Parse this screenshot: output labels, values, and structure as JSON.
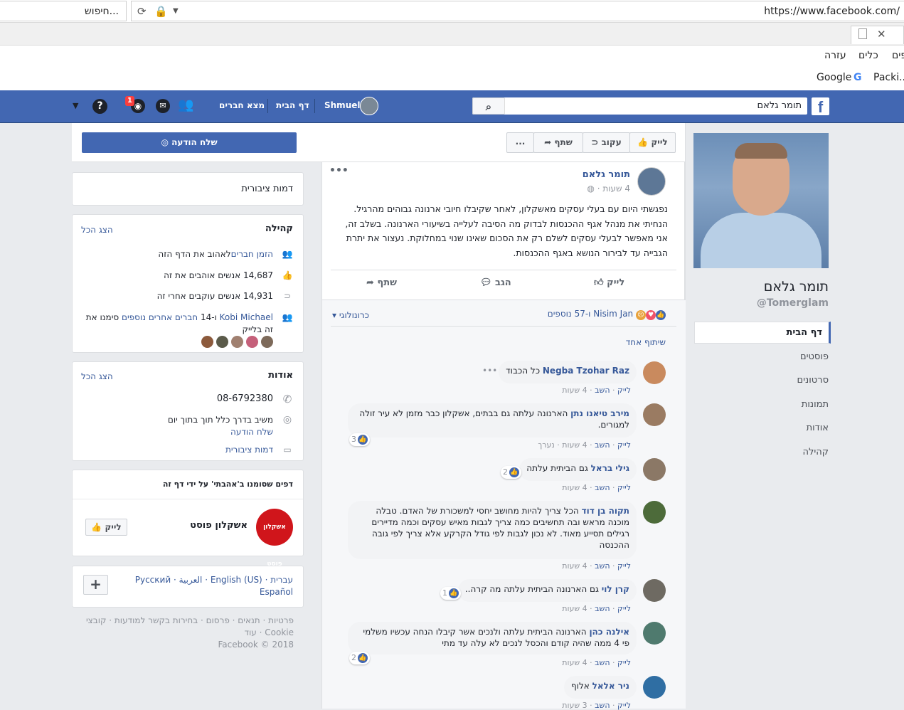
{
  "browser": {
    "search_value": "חיפוש...",
    "url": "https://www.facebook.com/",
    "menu": [
      "פים",
      "כלים",
      "עזרה"
    ],
    "favorites": [
      "Packi...",
      "Google"
    ]
  },
  "fb_header": {
    "search_value": "תומר גלאם",
    "user_name": "Shmuel",
    "home": "דף הבית",
    "find_friends": "מצא חברים",
    "notif_count": "1"
  },
  "profile": {
    "name": "תומר גלאם",
    "username": "@Tomerglam",
    "nav": [
      "דף הבית",
      "פוסטים",
      "סרטונים",
      "תמונות",
      "אודות",
      "קהילה"
    ]
  },
  "actions": {
    "like": "לייק",
    "follow": "עקוב",
    "share": "שתף",
    "more": "...",
    "send_message": "שלח הודעה"
  },
  "post": {
    "author": "תומר גלאם",
    "time": "4 שעות ·",
    "text": "נפגשתי היום עם בעלי עסקים מאשקלון, לאחר שקיבלו חיובי ארנונה גבוהים מהרגיל. הנחיתי את מנהל אגף ההכנסות לבדוק מה הסיבה לעלייה בשיעורי הארנונה. בשלב זה, אני מאפשר לבעלי עסקים לשלם רק את הסכום שאינו שנוי במחלוקת. נעצור את יתרת הגבייה עד לבירור הנושא באגף ההכנסות.",
    "like": "לייק",
    "comment": "הגב",
    "share": "שתף",
    "reactions": "Nisim Jan ו-57 נוספים",
    "chronological": "כרונולוגי",
    "one_share": "שיתוף אחד"
  },
  "comments": [
    {
      "name": "Negba Tzohar Raz",
      "text": "כל הכבוד",
      "meta_like": "לייק",
      "meta_reply": "השב",
      "time": "4 שעות",
      "likes": "",
      "extra": ""
    },
    {
      "name": "מירב טיאנו נתן",
      "text": "הארנונה עלתה גם בבתים, אשקלון כבר מזמן לא עיר זולה למגורים.",
      "meta_like": "לייק",
      "meta_reply": "השב",
      "time": "4 שעות",
      "likes": "3",
      "extra": "נערך"
    },
    {
      "name": "גילי בראל",
      "text": "גם הביתית עלתה",
      "meta_like": "לייק",
      "meta_reply": "השב",
      "time": "4 שעות",
      "likes": "2",
      "extra": ""
    },
    {
      "name": "תקוה בן דוד",
      "text": "הכל צריך להיות מחושב יחסי למשכורת של האדם. טבלה מוכנה מראש ובה תחשיבים כמה צריך לגבות מאיש עסקים וכמה מדיירים רגילים תסייע מאוד. לא נכון לגבות לפי גודל הקרקע אלא צריך לפי גובה ההכנסה",
      "meta_like": "לייק",
      "meta_reply": "השב",
      "time": "4 שעות",
      "likes": "",
      "extra": ""
    },
    {
      "name": "קרן לוי",
      "text": "גם הארנונה הביתית עלתה מה קרה..",
      "meta_like": "לייק",
      "meta_reply": "השב",
      "time": "4 שעות",
      "likes": "1",
      "extra": ""
    },
    {
      "name": "אילנה כהן",
      "text": "הארנונה הביתית עלתה ולנכים אשר קיבלו הנחה עכשיו משלמי פי 4 ממה שהיה קודם והכסל לנכים לא עלה עד מתי",
      "meta_like": "לייק",
      "meta_reply": "השב",
      "time": "4 שעות",
      "likes": "2",
      "extra": ""
    },
    {
      "name": "ניר אלאל",
      "text": "אלוף",
      "meta_like": "לייק",
      "meta_reply": "השב",
      "time": "3 שעות",
      "likes": "",
      "extra": ""
    }
  ],
  "right": {
    "category": "דמות ציבורית",
    "community_title": "קהילה",
    "see_all": "הצג הכל",
    "invite_link": "הזמן חברים",
    "invite_rest": "לאהוב את הדף הזה",
    "likes": "14,687 אנשים אוהבים את זה",
    "follows": "14,931 אנשים עוקבים אחרי זה",
    "friends_like_name": "Kobi Michael",
    "friends_like_mid": "ו-14",
    "friends_like_link": "חברים אחרים נוספים",
    "friends_like_rest": "סימנו את",
    "friends_like_tail": "זה בלייק",
    "about_title": "אודות",
    "phone": "08-6792380",
    "response": "משיב בדרך כלל תוך בתוך יום",
    "send_message": "שלח הודעה",
    "public_figure": "דמות ציבורית",
    "liked_pages_title": "דפים שסומנו ב'אהבתי' על ידי דף זה",
    "liked_page_name": "אשקלון פוסט",
    "liked_page_like": "לייק",
    "languages": "עברית · English (US) · العربية · Русский",
    "lang_es": "Español",
    "footer1": "פרטיות · תנאים · פרסום · בחירות בקשר למודעות · קובצי",
    "footer2": "Cookie · עוד",
    "footer3": "Facebook © 2018"
  },
  "colors": {
    "brand": "#4267b2",
    "link": "#365899"
  }
}
